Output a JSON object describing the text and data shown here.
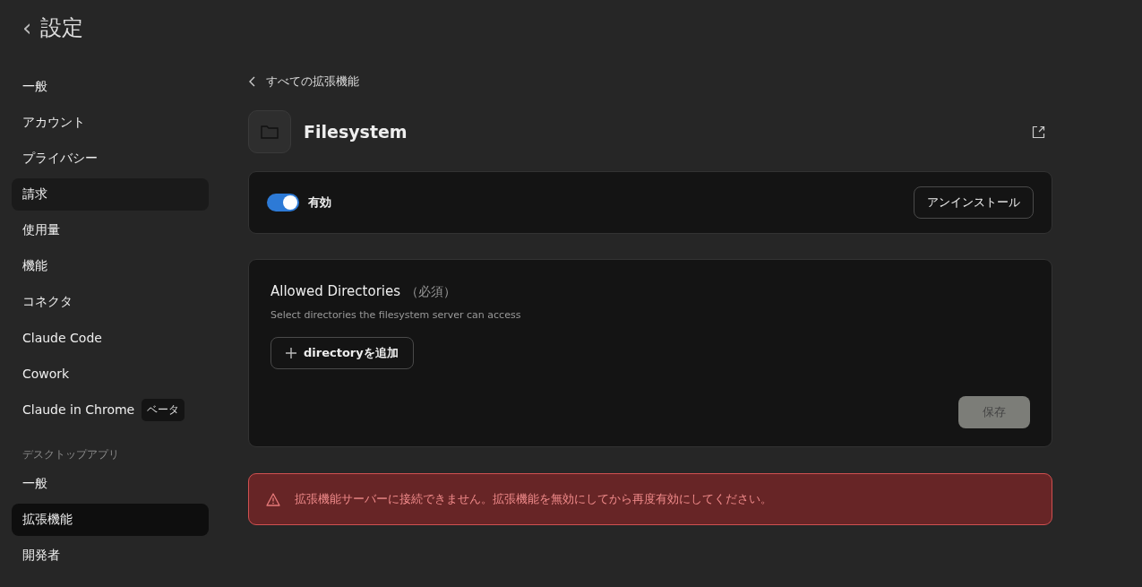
{
  "header": {
    "back": "‹",
    "title": "設定"
  },
  "sidebar": {
    "sections": [
      {
        "items": [
          {
            "label": "一般",
            "selected": false,
            "hovered": false
          },
          {
            "label": "アカウント",
            "selected": false,
            "hovered": false
          },
          {
            "label": "プライバシー",
            "selected": false,
            "hovered": false
          },
          {
            "label": "請求",
            "selected": false,
            "hovered": true
          },
          {
            "label": "使用量",
            "selected": false,
            "hovered": false
          },
          {
            "label": "機能",
            "selected": false,
            "hovered": false
          },
          {
            "label": "コネクタ",
            "selected": false,
            "hovered": false
          },
          {
            "label": "Claude Code",
            "selected": false,
            "hovered": false
          },
          {
            "label": "Cowork",
            "selected": false,
            "hovered": false
          },
          {
            "label": "Claude in Chrome",
            "badge": "ベータ",
            "selected": false,
            "hovered": false
          }
        ]
      },
      {
        "heading": "デスクトップアプリ",
        "items": [
          {
            "label": "一般",
            "selected": false,
            "hovered": false
          },
          {
            "label": "拡張機能",
            "selected": true,
            "hovered": false
          },
          {
            "label": "開発者",
            "selected": false,
            "hovered": false
          }
        ]
      }
    ]
  },
  "breadcrumb": "すべての拡張機能",
  "extension": {
    "name": "Filesystem"
  },
  "enable_card": {
    "toggle": {
      "label": "有効",
      "on": true
    },
    "uninstall_button": "アンインストール"
  },
  "settings_card": {
    "title": "Allowed Directories",
    "required": "（必須）",
    "description": "Select directories the filesystem server can access",
    "add_button": "directoryを追加",
    "save_button": {
      "label": "保存",
      "disabled": true
    }
  },
  "error": {
    "message": "拡張機能サーバーに接続できません。拡張機能を無効にしてから再度有効にしてください。"
  }
}
